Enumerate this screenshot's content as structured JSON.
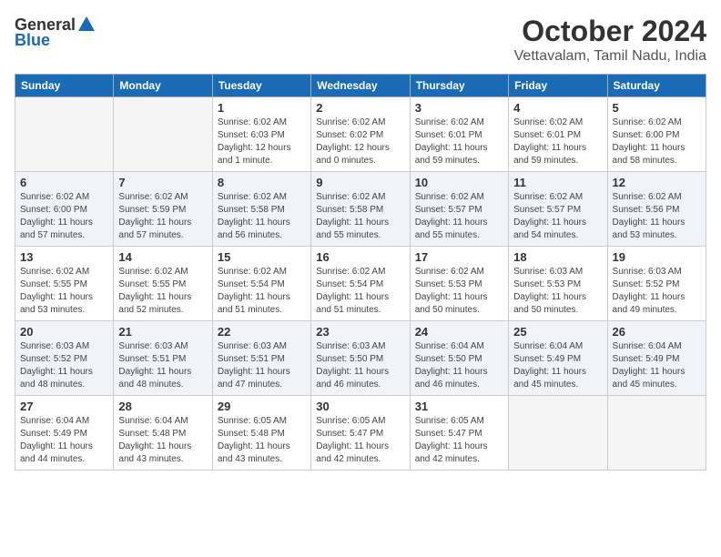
{
  "logo": {
    "general": "General",
    "blue": "Blue"
  },
  "title": {
    "month": "October 2024",
    "location": "Vettavalam, Tamil Nadu, India"
  },
  "headers": [
    "Sunday",
    "Monday",
    "Tuesday",
    "Wednesday",
    "Thursday",
    "Friday",
    "Saturday"
  ],
  "weeks": [
    [
      {
        "day": "",
        "sunrise": "",
        "sunset": "",
        "daylight": "",
        "empty": true
      },
      {
        "day": "",
        "sunrise": "",
        "sunset": "",
        "daylight": "",
        "empty": true
      },
      {
        "day": "1",
        "sunrise": "Sunrise: 6:02 AM",
        "sunset": "Sunset: 6:03 PM",
        "daylight": "Daylight: 12 hours and 1 minute.",
        "empty": false
      },
      {
        "day": "2",
        "sunrise": "Sunrise: 6:02 AM",
        "sunset": "Sunset: 6:02 PM",
        "daylight": "Daylight: 12 hours and 0 minutes.",
        "empty": false
      },
      {
        "day": "3",
        "sunrise": "Sunrise: 6:02 AM",
        "sunset": "Sunset: 6:01 PM",
        "daylight": "Daylight: 11 hours and 59 minutes.",
        "empty": false
      },
      {
        "day": "4",
        "sunrise": "Sunrise: 6:02 AM",
        "sunset": "Sunset: 6:01 PM",
        "daylight": "Daylight: 11 hours and 59 minutes.",
        "empty": false
      },
      {
        "day": "5",
        "sunrise": "Sunrise: 6:02 AM",
        "sunset": "Sunset: 6:00 PM",
        "daylight": "Daylight: 11 hours and 58 minutes.",
        "empty": false
      }
    ],
    [
      {
        "day": "6",
        "sunrise": "Sunrise: 6:02 AM",
        "sunset": "Sunset: 6:00 PM",
        "daylight": "Daylight: 11 hours and 57 minutes.",
        "empty": false
      },
      {
        "day": "7",
        "sunrise": "Sunrise: 6:02 AM",
        "sunset": "Sunset: 5:59 PM",
        "daylight": "Daylight: 11 hours and 57 minutes.",
        "empty": false
      },
      {
        "day": "8",
        "sunrise": "Sunrise: 6:02 AM",
        "sunset": "Sunset: 5:58 PM",
        "daylight": "Daylight: 11 hours and 56 minutes.",
        "empty": false
      },
      {
        "day": "9",
        "sunrise": "Sunrise: 6:02 AM",
        "sunset": "Sunset: 5:58 PM",
        "daylight": "Daylight: 11 hours and 55 minutes.",
        "empty": false
      },
      {
        "day": "10",
        "sunrise": "Sunrise: 6:02 AM",
        "sunset": "Sunset: 5:57 PM",
        "daylight": "Daylight: 11 hours and 55 minutes.",
        "empty": false
      },
      {
        "day": "11",
        "sunrise": "Sunrise: 6:02 AM",
        "sunset": "Sunset: 5:57 PM",
        "daylight": "Daylight: 11 hours and 54 minutes.",
        "empty": false
      },
      {
        "day": "12",
        "sunrise": "Sunrise: 6:02 AM",
        "sunset": "Sunset: 5:56 PM",
        "daylight": "Daylight: 11 hours and 53 minutes.",
        "empty": false
      }
    ],
    [
      {
        "day": "13",
        "sunrise": "Sunrise: 6:02 AM",
        "sunset": "Sunset: 5:55 PM",
        "daylight": "Daylight: 11 hours and 53 minutes.",
        "empty": false
      },
      {
        "day": "14",
        "sunrise": "Sunrise: 6:02 AM",
        "sunset": "Sunset: 5:55 PM",
        "daylight": "Daylight: 11 hours and 52 minutes.",
        "empty": false
      },
      {
        "day": "15",
        "sunrise": "Sunrise: 6:02 AM",
        "sunset": "Sunset: 5:54 PM",
        "daylight": "Daylight: 11 hours and 51 minutes.",
        "empty": false
      },
      {
        "day": "16",
        "sunrise": "Sunrise: 6:02 AM",
        "sunset": "Sunset: 5:54 PM",
        "daylight": "Daylight: 11 hours and 51 minutes.",
        "empty": false
      },
      {
        "day": "17",
        "sunrise": "Sunrise: 6:02 AM",
        "sunset": "Sunset: 5:53 PM",
        "daylight": "Daylight: 11 hours and 50 minutes.",
        "empty": false
      },
      {
        "day": "18",
        "sunrise": "Sunrise: 6:03 AM",
        "sunset": "Sunset: 5:53 PM",
        "daylight": "Daylight: 11 hours and 50 minutes.",
        "empty": false
      },
      {
        "day": "19",
        "sunrise": "Sunrise: 6:03 AM",
        "sunset": "Sunset: 5:52 PM",
        "daylight": "Daylight: 11 hours and 49 minutes.",
        "empty": false
      }
    ],
    [
      {
        "day": "20",
        "sunrise": "Sunrise: 6:03 AM",
        "sunset": "Sunset: 5:52 PM",
        "daylight": "Daylight: 11 hours and 48 minutes.",
        "empty": false
      },
      {
        "day": "21",
        "sunrise": "Sunrise: 6:03 AM",
        "sunset": "Sunset: 5:51 PM",
        "daylight": "Daylight: 11 hours and 48 minutes.",
        "empty": false
      },
      {
        "day": "22",
        "sunrise": "Sunrise: 6:03 AM",
        "sunset": "Sunset: 5:51 PM",
        "daylight": "Daylight: 11 hours and 47 minutes.",
        "empty": false
      },
      {
        "day": "23",
        "sunrise": "Sunrise: 6:03 AM",
        "sunset": "Sunset: 5:50 PM",
        "daylight": "Daylight: 11 hours and 46 minutes.",
        "empty": false
      },
      {
        "day": "24",
        "sunrise": "Sunrise: 6:04 AM",
        "sunset": "Sunset: 5:50 PM",
        "daylight": "Daylight: 11 hours and 46 minutes.",
        "empty": false
      },
      {
        "day": "25",
        "sunrise": "Sunrise: 6:04 AM",
        "sunset": "Sunset: 5:49 PM",
        "daylight": "Daylight: 11 hours and 45 minutes.",
        "empty": false
      },
      {
        "day": "26",
        "sunrise": "Sunrise: 6:04 AM",
        "sunset": "Sunset: 5:49 PM",
        "daylight": "Daylight: 11 hours and 45 minutes.",
        "empty": false
      }
    ],
    [
      {
        "day": "27",
        "sunrise": "Sunrise: 6:04 AM",
        "sunset": "Sunset: 5:49 PM",
        "daylight": "Daylight: 11 hours and 44 minutes.",
        "empty": false
      },
      {
        "day": "28",
        "sunrise": "Sunrise: 6:04 AM",
        "sunset": "Sunset: 5:48 PM",
        "daylight": "Daylight: 11 hours and 43 minutes.",
        "empty": false
      },
      {
        "day": "29",
        "sunrise": "Sunrise: 6:05 AM",
        "sunset": "Sunset: 5:48 PM",
        "daylight": "Daylight: 11 hours and 43 minutes.",
        "empty": false
      },
      {
        "day": "30",
        "sunrise": "Sunrise: 6:05 AM",
        "sunset": "Sunset: 5:47 PM",
        "daylight": "Daylight: 11 hours and 42 minutes.",
        "empty": false
      },
      {
        "day": "31",
        "sunrise": "Sunrise: 6:05 AM",
        "sunset": "Sunset: 5:47 PM",
        "daylight": "Daylight: 11 hours and 42 minutes.",
        "empty": false
      },
      {
        "day": "",
        "sunrise": "",
        "sunset": "",
        "daylight": "",
        "empty": true
      },
      {
        "day": "",
        "sunrise": "",
        "sunset": "",
        "daylight": "",
        "empty": true
      }
    ]
  ]
}
